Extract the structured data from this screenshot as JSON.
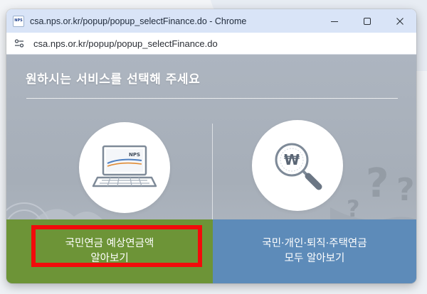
{
  "browser": {
    "favicon_text": "NPS",
    "title": "csa.nps.or.kr/popup/popup_selectFinance.do - Chrome",
    "url": "csa.nps.or.kr/popup/popup_selectFinance.do",
    "controls": [
      "minimize-icon",
      "maximize-icon",
      "close-icon"
    ]
  },
  "popup": {
    "heading": "원하시는 서비스를 선택해 주세요",
    "laptop_screen_text": "NPS",
    "options": [
      {
        "icon": "laptop-icon",
        "line1": "국민연금 예상연금액",
        "line2": "알아보기",
        "color": "#6d9437",
        "highlighted": true
      },
      {
        "icon": "won-magnifier-icon",
        "line1": "국민·개인·퇴직·주택연금",
        "line2": "모두 알아보기",
        "color": "#5d8bb9",
        "highlighted": false
      }
    ],
    "highlight_color": "#f20b0b"
  }
}
